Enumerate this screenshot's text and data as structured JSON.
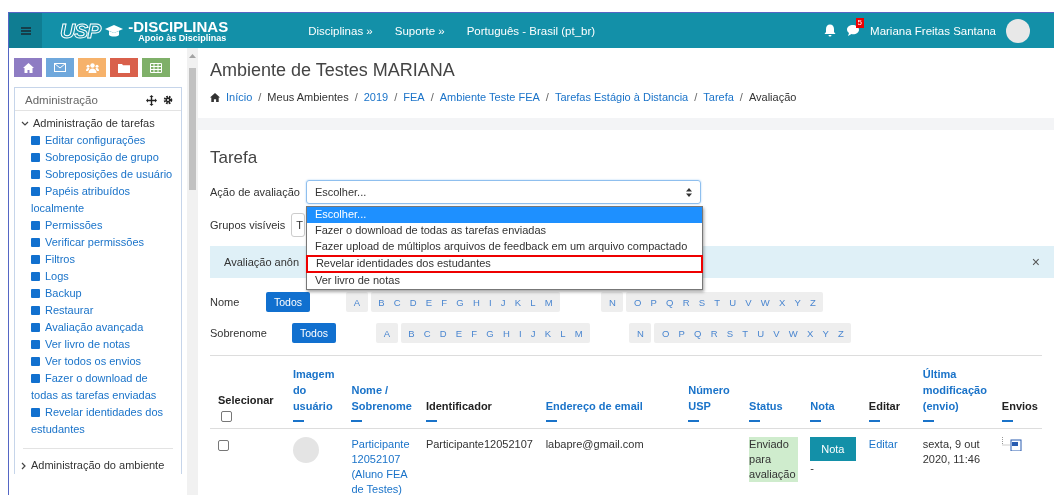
{
  "navbar": {
    "logo": {
      "mark": "USP",
      "name": "-DISCIPLINAS",
      "tagline": "Apoio às Disciplinas"
    },
    "links": [
      "Disciplinas »",
      "Suporte »",
      "Português - Brasil (pt_br)"
    ],
    "message_badge": "5",
    "user_name": "Mariana Freitas Santana"
  },
  "sidebar": {
    "quick_buttons": [
      {
        "kind": "home",
        "color": "#8e7cc3"
      },
      {
        "kind": "mail",
        "color": "#6fa8dc"
      },
      {
        "kind": "users",
        "color": "#f6b26b"
      },
      {
        "kind": "folder",
        "color": "#d9604b"
      },
      {
        "kind": "table",
        "color": "#7fb069"
      }
    ],
    "block_title": "Administração",
    "tree": [
      {
        "label": "Administração de tarefas",
        "expanded": true,
        "children": [
          {
            "label": "Editar configurações"
          },
          {
            "label": "Sobreposição de grupo"
          },
          {
            "label": "Sobreposições de usuário"
          },
          {
            "label": "Papéis atribuídos localmente"
          },
          {
            "label": "Permissões"
          },
          {
            "label": "Verificar permissões"
          },
          {
            "label": "Filtros"
          },
          {
            "label": "Logs"
          },
          {
            "label": "Backup"
          },
          {
            "label": "Restaurar"
          },
          {
            "label": "Avaliação avançada"
          },
          {
            "label": "Ver livro de notas"
          },
          {
            "label": "Ver todos os envios"
          },
          {
            "label": "Fazer o download de todas as tarefas enviadas"
          },
          {
            "label": "Revelar identidades dos estudantes"
          }
        ]
      },
      {
        "label": "Administração do ambiente",
        "expanded": false
      }
    ]
  },
  "header": {
    "title": "Ambiente de Testes MARIANA",
    "separator": "/",
    "breadcrumb": [
      {
        "label": "Início",
        "link": true
      },
      {
        "label": "Meus Ambientes",
        "link": false
      },
      {
        "label": "2019",
        "link": true
      },
      {
        "label": "FEA",
        "link": true
      },
      {
        "label": "Ambiente Teste FEA",
        "link": true
      },
      {
        "label": "Tarefas Estágio à Distancia",
        "link": true
      },
      {
        "label": "Tarefa",
        "link": true
      },
      {
        "label": "Avaliação",
        "link": false
      }
    ]
  },
  "grading": {
    "heading": "Tarefa",
    "action_label": "Ação de avaliação",
    "action_value": "Escolher...",
    "action_options": [
      {
        "label": "Escolher...",
        "selected": true,
        "highlighted": false
      },
      {
        "label": "Fazer o download de todas as tarefas enviadas",
        "selected": false,
        "highlighted": false
      },
      {
        "label": "Fazer upload de múltiplos arquivos de feedback em um arquivo compactado",
        "selected": false,
        "highlighted": false
      },
      {
        "label": "Revelar identidades dos estudantes",
        "selected": false,
        "highlighted": true
      },
      {
        "label": "Ver livro de notas",
        "selected": false,
        "highlighted": false
      }
    ],
    "groups_label": "Grupos visíveis",
    "groups_value": "T",
    "notice": "Avaliação anôn",
    "notice_close": "×",
    "filters": [
      {
        "label": "Nome",
        "all": "Todos",
        "all_selected": true,
        "letters": [
          {
            "label": "A",
            "selected": false
          },
          {
            "label": "B",
            "selected": false
          },
          {
            "label": "C",
            "selected": false
          },
          {
            "label": "D",
            "selected": false
          },
          {
            "label": "E",
            "selected": false
          },
          {
            "label": "F",
            "selected": false
          },
          {
            "label": "G",
            "selected": false
          },
          {
            "label": "H",
            "selected": false
          },
          {
            "label": "I",
            "selected": false
          },
          {
            "label": "J",
            "selected": false
          },
          {
            "label": "K",
            "selected": false
          },
          {
            "label": "L",
            "selected": false
          },
          {
            "label": "M",
            "selected": false
          },
          {
            "label": "N",
            "selected": false
          },
          {
            "label": "O",
            "selected": false
          },
          {
            "label": "P",
            "selected": false
          },
          {
            "label": "Q",
            "selected": false
          },
          {
            "label": "R",
            "selected": false
          },
          {
            "label": "S",
            "selected": false
          },
          {
            "label": "T",
            "selected": false
          },
          {
            "label": "U",
            "selected": false
          },
          {
            "label": "V",
            "selected": false
          },
          {
            "label": "W",
            "selected": false
          },
          {
            "label": "X",
            "selected": false
          },
          {
            "label": "Y",
            "selected": false
          },
          {
            "label": "Z",
            "selected": false
          }
        ]
      },
      {
        "label": "Sobrenome",
        "all": "Todos",
        "all_selected": true,
        "letters": [
          {
            "label": "A",
            "selected": false
          },
          {
            "label": "B",
            "selected": false
          },
          {
            "label": "C",
            "selected": false
          },
          {
            "label": "D",
            "selected": false
          },
          {
            "label": "E",
            "selected": false
          },
          {
            "label": "F",
            "selected": false
          },
          {
            "label": "G",
            "selected": false
          },
          {
            "label": "H",
            "selected": false
          },
          {
            "label": "I",
            "selected": false
          },
          {
            "label": "J",
            "selected": false
          },
          {
            "label": "K",
            "selected": false
          },
          {
            "label": "L",
            "selected": false
          },
          {
            "label": "M",
            "selected": false
          },
          {
            "label": "N",
            "selected": false
          },
          {
            "label": "O",
            "selected": false
          },
          {
            "label": "P",
            "selected": false
          },
          {
            "label": "Q",
            "selected": false
          },
          {
            "label": "R",
            "selected": false
          },
          {
            "label": "S",
            "selected": false
          },
          {
            "label": "T",
            "selected": false
          },
          {
            "label": "U",
            "selected": false
          },
          {
            "label": "V",
            "selected": false
          },
          {
            "label": "W",
            "selected": false
          },
          {
            "label": "X",
            "selected": false
          },
          {
            "label": "Y",
            "selected": false
          },
          {
            "label": "Z",
            "selected": false
          }
        ]
      }
    ],
    "table": {
      "select_all_checked": false,
      "columns": [
        {
          "label": "Selecionar",
          "sortable": false,
          "kind": "select"
        },
        {
          "label": "Imagem do usuário",
          "sortable": true,
          "kind": "text"
        },
        {
          "label": "Nome / Sobrenome",
          "sortable": true,
          "kind": "text"
        },
        {
          "label": "Identificador",
          "sortable": false,
          "kind": "text"
        },
        {
          "label": "Endereço de email",
          "sortable": true,
          "kind": "text"
        },
        {
          "label": "Número USP",
          "sortable": true,
          "kind": "text"
        },
        {
          "label": "Status",
          "sortable": true,
          "kind": "text"
        },
        {
          "label": "Nota",
          "sortable": true,
          "kind": "text"
        },
        {
          "label": "Editar",
          "sortable": false,
          "kind": "text"
        },
        {
          "label": "Última modificação (envio)",
          "sortable": true,
          "kind": "text"
        },
        {
          "label": "Envios",
          "sortable": false,
          "kind": "text"
        }
      ],
      "rows": [
        {
          "selected": false,
          "name": "Participante 12052107 (Aluno FEA de Testes)",
          "identifier": "Participante12052107",
          "email": "labapre@gmail.com",
          "status": "Enviado para avaliação",
          "grade_button": "Nota",
          "grade": "-",
          "edit": "Editar",
          "modified": "sexta, 9 out 2020, 11:46"
        }
      ]
    }
  }
}
